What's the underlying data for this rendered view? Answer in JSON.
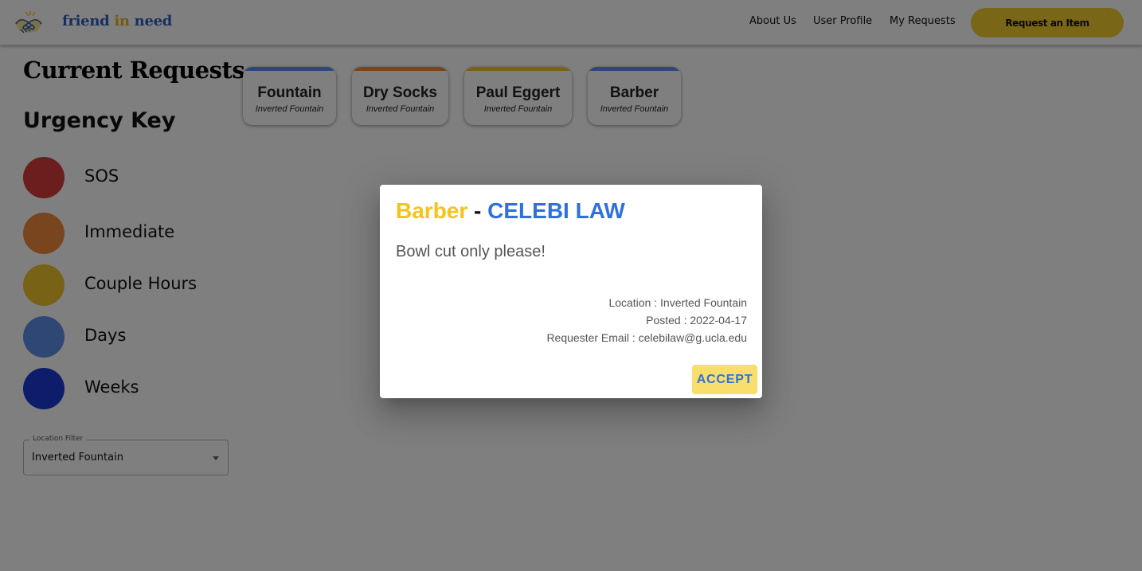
{
  "header": {
    "brand": {
      "part1": "friend",
      "part2": "in",
      "part3": "need"
    },
    "nav": [
      "About Us",
      "User Profile",
      "My Requests"
    ],
    "cta_label": "Request an Item"
  },
  "main": {
    "title": "Current Requests",
    "urgency_key": {
      "title": "Urgency Key",
      "items": [
        {
          "label": "SOS",
          "color": "#d83b3b"
        },
        {
          "label": "Immediate",
          "color": "#f08a3c"
        },
        {
          "label": "Couple Hours",
          "color": "#f0c42a"
        },
        {
          "label": "Days",
          "color": "#5d8ee8"
        },
        {
          "label": "Weeks",
          "color": "#1a39d6"
        }
      ]
    },
    "location_filter": {
      "legend": "Location Filter",
      "value": "Inverted Fountain"
    },
    "cards": [
      {
        "title": "Fountain",
        "location": "Inverted Fountain",
        "color": "#5d8ee8"
      },
      {
        "title": "Dry Socks",
        "location": "Inverted Fountain",
        "color": "#f08a3c"
      },
      {
        "title": "Paul Eggert",
        "location": "Inverted Fountain",
        "color": "#f0c42a"
      },
      {
        "title": "Barber",
        "location": "Inverted Fountain",
        "color": "#5d8ee8"
      }
    ]
  },
  "dialog": {
    "item": "Barber",
    "separator": "-",
    "user": "CELEBI LAW",
    "description": "Bowl cut only please!",
    "location": "Location : Inverted Fountain",
    "posted": "Posted : 2022-04-17",
    "email": "Requester Email : celebilaw@g.ucla.edu",
    "accept_label": "ACCEPT"
  }
}
